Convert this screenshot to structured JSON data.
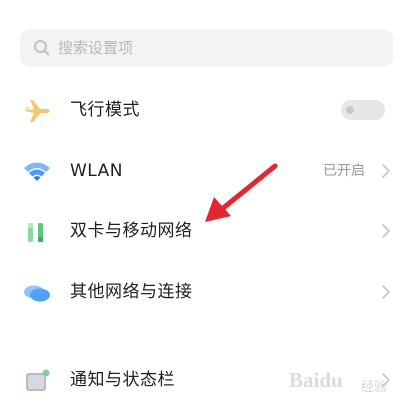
{
  "search": {
    "placeholder": "搜索设置项"
  },
  "items": [
    {
      "label": "飞行模式",
      "control": "toggle",
      "toggle_on": false,
      "icon": "airplane-icon"
    },
    {
      "label": "WLAN",
      "value": "已开启",
      "control": "chevron",
      "icon": "wifi-icon"
    },
    {
      "label": "双卡与移动网络",
      "control": "chevron",
      "icon": "sim-cards-icon"
    },
    {
      "label": "其他网络与连接",
      "control": "chevron",
      "icon": "cloud-network-icon"
    },
    {
      "label": "通知与状态栏",
      "control": "chevron",
      "icon": "notification-icon"
    }
  ],
  "colors": {
    "airplane": "#f5c76a",
    "wifi": "#3d8ff5",
    "sim": "#5ec782",
    "cloud": "#4fa3f7",
    "arrow": "#e4262f"
  },
  "watermark": {
    "text": "Baidu",
    "sub": "经验"
  }
}
